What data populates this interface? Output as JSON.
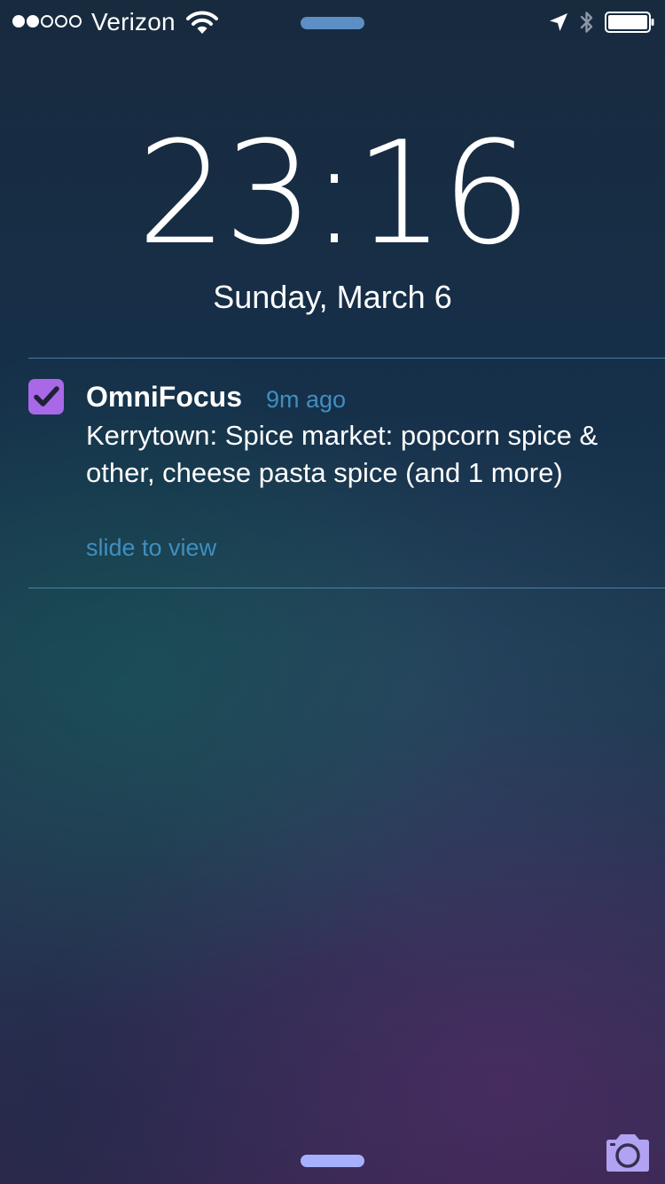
{
  "status_bar": {
    "signal_strength": 2,
    "signal_max": 5,
    "carrier": "Verizon",
    "battery_level": 1.0,
    "icons": [
      "wifi-icon",
      "location-arrow-icon",
      "bluetooth-icon",
      "battery-icon"
    ]
  },
  "lock_screen": {
    "time": "23:16",
    "date": "Sunday, March 6"
  },
  "notification": {
    "app_name": "OmniFocus",
    "app_icon": "checkbox-check-icon",
    "app_icon_color": "#a968e8",
    "time_ago": "9m ago",
    "message": "Kerrytown: Spice market: popcorn spice & other, cheese pasta spice (and 1 more)",
    "action": "slide to view"
  },
  "bottom": {
    "camera_icon": "camera-icon"
  },
  "colors": {
    "accent_text": "#3f8fbf",
    "top_grabber": "#5c8fc4",
    "bottom_grabber": "#a7b0ff",
    "camera": "#b1a2f2"
  }
}
